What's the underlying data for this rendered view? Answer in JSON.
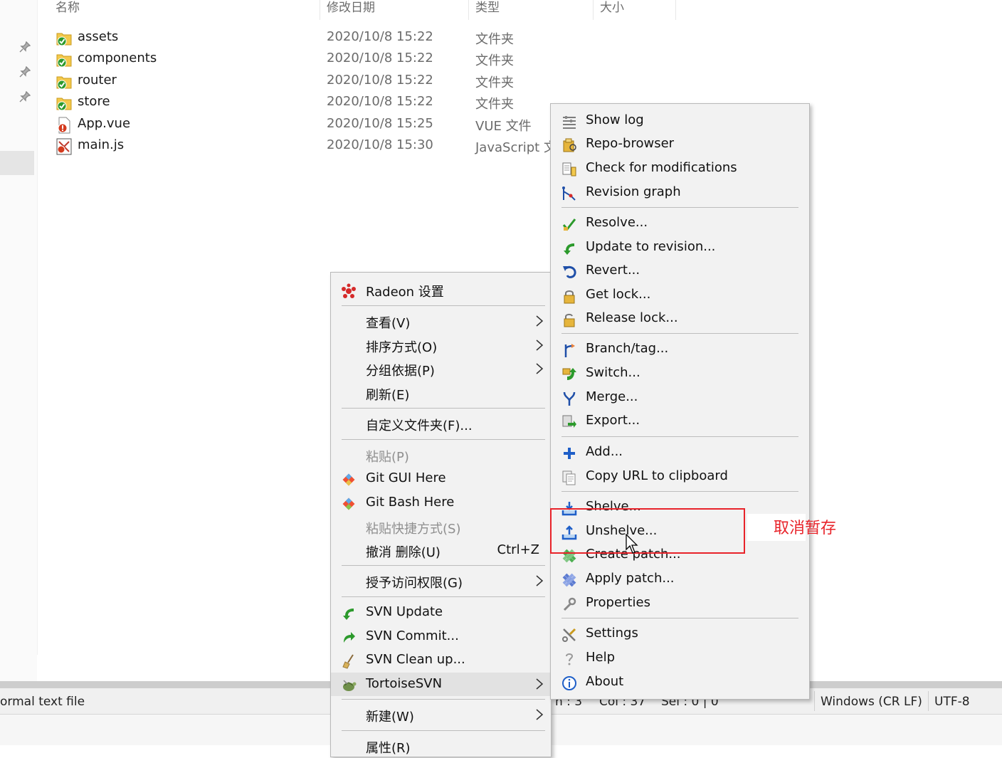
{
  "explorer": {
    "columns": {
      "name": "名称",
      "date": "修改日期",
      "type": "类型",
      "size": "大小"
    },
    "files": [
      {
        "name": "assets",
        "date": "2020/10/8 15:22",
        "type": "文件夹",
        "icon": "svn-folder-icon"
      },
      {
        "name": "components",
        "date": "2020/10/8 15:22",
        "type": "文件夹",
        "icon": "svn-folder-icon"
      },
      {
        "name": "router",
        "date": "2020/10/8 15:22",
        "type": "文件夹",
        "icon": "svn-folder-icon"
      },
      {
        "name": "store",
        "date": "2020/10/8 15:22",
        "type": "文件夹",
        "icon": "svn-folder-icon"
      },
      {
        "name": "App.vue",
        "date": "2020/10/8 15:25",
        "type": "VUE 文件",
        "icon": "svn-modified-file-icon"
      },
      {
        "name": "main.js",
        "date": "2020/10/8 15:30",
        "type": "JavaScript 文",
        "icon": "svn-js-file-icon"
      }
    ]
  },
  "status_bar": {
    "file_type": "ormal text file",
    "line": "n : 3",
    "col": "Col : 37",
    "sel": "Sel : 0 | 0",
    "eol": "Windows (CR LF)",
    "encoding": "UTF-8"
  },
  "context_menu": {
    "radeon": "Radeon 设置",
    "view": "查看(V)",
    "sort": "排序方式(O)",
    "group": "分组依据(P)",
    "refresh": "刷新(E)",
    "customize": "自定义文件夹(F)...",
    "paste": "粘贴(P)",
    "git_gui": "Git GUI Here",
    "git_bash": "Git Bash Here",
    "paste_shortcut": "粘贴快捷方式(S)",
    "undo_delete": "撤消 删除(U)",
    "undo_shortcut": "Ctrl+Z",
    "grant_access": "授予访问权限(G)",
    "svn_update": "SVN Update",
    "svn_commit": "SVN Commit...",
    "svn_cleanup": "SVN Clean up...",
    "tortoise": "TortoiseSVN",
    "new": "新建(W)",
    "properties": "属性(R)"
  },
  "tortoise_menu": {
    "show_log": "Show log",
    "repo_browser": "Repo-browser",
    "check_mods": "Check for modifications",
    "revision_graph": "Revision graph",
    "resolve": "Resolve...",
    "update_rev": "Update to revision...",
    "revert": "Revert...",
    "get_lock": "Get lock...",
    "release_lock": "Release lock...",
    "branch_tag": "Branch/tag...",
    "switch": "Switch...",
    "merge": "Merge...",
    "export": "Export...",
    "add": "Add...",
    "copy_url": "Copy URL to clipboard",
    "shelve": "Shelve...",
    "unshelve": "Unshelve...",
    "create_patch": "Create patch...",
    "apply_patch": "Apply patch...",
    "properties": "Properties",
    "settings": "Settings",
    "help": "Help",
    "about": "About"
  },
  "annotation": {
    "text": "取消暂存",
    "color": "#e8232a"
  },
  "colors": {
    "menu_bg": "#f2f2f2",
    "hover": "#e2e2e2",
    "annotation_red": "#e8232a",
    "svn_green": "#2c9a2c"
  }
}
